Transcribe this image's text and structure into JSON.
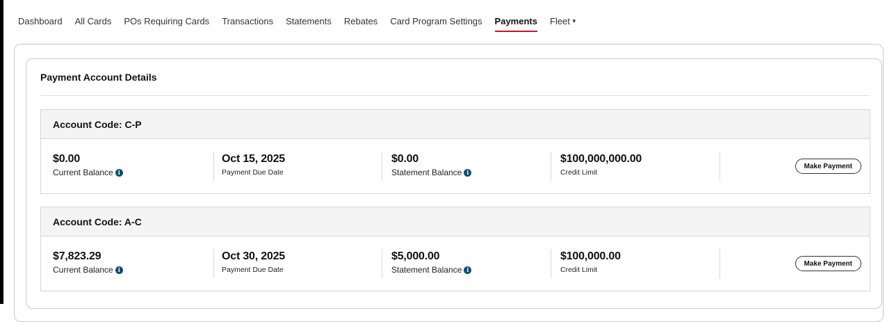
{
  "nav": {
    "items": [
      {
        "label": "Dashboard"
      },
      {
        "label": "All Cards"
      },
      {
        "label": "POs Requiring Cards"
      },
      {
        "label": "Transactions"
      },
      {
        "label": "Statements"
      },
      {
        "label": "Rebates"
      },
      {
        "label": "Card Program Settings"
      },
      {
        "label": "Payments"
      },
      {
        "label": "Fleet"
      }
    ],
    "active": "Payments"
  },
  "card": {
    "title": "Payment Account Details"
  },
  "accounts": [
    {
      "header": "Account Code: C-P",
      "current_balance": "$0.00",
      "current_balance_label": "Current Balance",
      "due_date": "Oct 15, 2025",
      "due_date_label": "Payment Due Date",
      "statement_balance": "$0.00",
      "statement_balance_label": "Statement Balance",
      "credit_limit": "$100,000,000.00",
      "credit_limit_label": "Credit Limit",
      "button_label": "Make Payment"
    },
    {
      "header": "Account Code: A-C",
      "current_balance": "$7,823.29",
      "current_balance_label": "Current Balance",
      "due_date": "Oct 30, 2025",
      "due_date_label": "Payment Due Date",
      "statement_balance": "$5,000.00",
      "statement_balance_label": "Statement Balance",
      "credit_limit": "$100,000.00",
      "credit_limit_label": "Credit Limit",
      "button_label": "Make Payment"
    }
  ],
  "colors": {
    "accent": "#c8102e",
    "info": "#0f4d70"
  },
  "icons": {
    "info": "info-icon",
    "dropdown": "caret-down-icon"
  }
}
